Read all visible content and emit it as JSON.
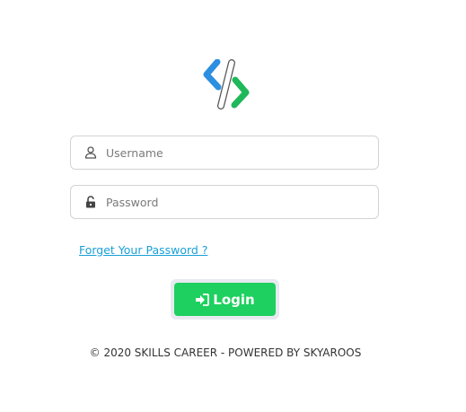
{
  "form": {
    "username_placeholder": "Username",
    "password_placeholder": "Password",
    "forgot_link": "Forget Your Password ?",
    "login_label": "Login"
  },
  "footer": {
    "text": "© 2020 SKILLS CAREER - POWERED BY SKYAROOS"
  },
  "icons": {
    "username": "user-icon",
    "password": "unlock-icon",
    "login": "sign-in-icon",
    "logo": "brand-logo"
  },
  "colors": {
    "login_button": "#1ed05f",
    "link": "#1a9fd6",
    "logo_blue": "#2d8fe0",
    "logo_green": "#1fb85a"
  }
}
